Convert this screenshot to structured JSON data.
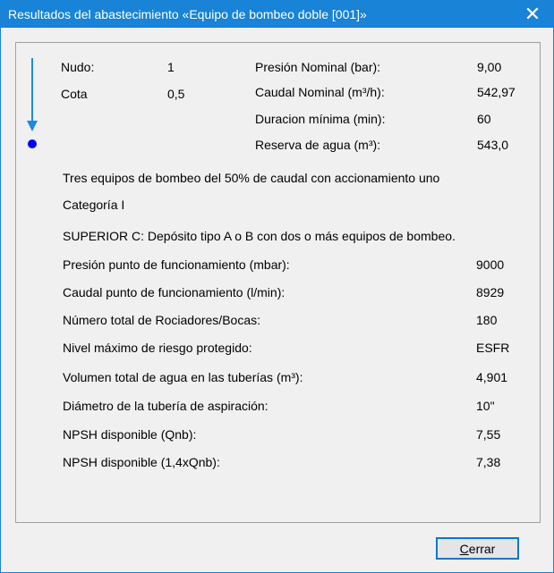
{
  "window": {
    "title": "Resultados del abastecimiento «Equipo de bombeo doble [001]»",
    "close_glyph": "✕"
  },
  "colors": {
    "titlebar": "#1883d7",
    "arrow": "#1e88e5",
    "node_dot": "#0000ff"
  },
  "icons": {
    "flow_arrow": "arrow-down-icon",
    "node": "node-dot-icon"
  },
  "node": {
    "nudo_label": "Nudo:",
    "nudo_value": "1",
    "cota_label": "Cota",
    "cota_value": "0,5"
  },
  "nominal": [
    {
      "label": "Presión Nominal (bar):",
      "value": "9,00"
    },
    {
      "label": "Caudal Nominal (m³/h):",
      "value": "542,97"
    },
    {
      "label": "Duracion mínima (min):",
      "value": "60"
    },
    {
      "label": "Reserva de agua (m³):",
      "value": "543,0"
    }
  ],
  "description": [
    "Tres equipos de bombeo del 50% de caudal con accionamiento uno",
    "Categoría I",
    "SUPERIOR C: Depósito tipo A o B con dos o más equipos de bombeo."
  ],
  "results": [
    {
      "label": "Presión punto de funcionamiento (mbar):",
      "value": "9000"
    },
    {
      "label": "Caudal punto de funcionamiento (l/min):",
      "value": "8929"
    },
    {
      "label": "Número total de Rociadores/Bocas:",
      "value": "180"
    },
    {
      "label": "Nivel máximo de riesgo protegido:",
      "value": "ESFR"
    },
    {
      "label": "Volumen total de agua en las tuberías (m³):",
      "value": "4,901"
    },
    {
      "label": "Diámetro de la tubería de aspiración:",
      "value": "10\""
    },
    {
      "label": "NPSH disponible (Qnb):",
      "value": "7,55"
    },
    {
      "label": "NPSH disponible (1,4xQnb):",
      "value": "7,38"
    }
  ],
  "buttons": {
    "close_accel": "C",
    "close_rest": "errar"
  }
}
